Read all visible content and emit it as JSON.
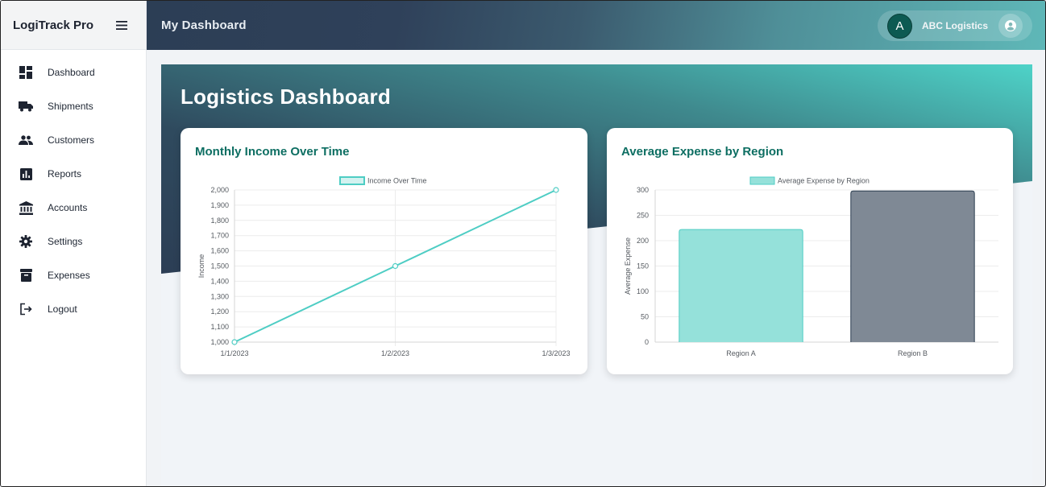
{
  "app": {
    "title": "LogiTrack Pro"
  },
  "sidebar": {
    "items": [
      {
        "label": "Dashboard",
        "icon": "dashboard-icon"
      },
      {
        "label": "Shipments",
        "icon": "truck-icon"
      },
      {
        "label": "Customers",
        "icon": "people-icon"
      },
      {
        "label": "Reports",
        "icon": "chart-icon"
      },
      {
        "label": "Accounts",
        "icon": "bank-icon"
      },
      {
        "label": "Settings",
        "icon": "gear-icon"
      },
      {
        "label": "Expenses",
        "icon": "archive-icon"
      },
      {
        "label": "Logout",
        "icon": "logout-icon"
      }
    ]
  },
  "header": {
    "title": "My Dashboard",
    "avatar_letter": "A",
    "company": "ABC Logistics"
  },
  "main": {
    "title": "Logistics Dashboard"
  },
  "colors": {
    "teal": "#4ecdc4",
    "teal_fill": "#95e1da",
    "slate": "#2c3e50",
    "slate_fill": "#7f8995",
    "card_title": "#0d6e62"
  },
  "charts": {
    "income": {
      "title": "Monthly Income Over Time"
    },
    "expense": {
      "title": "Average Expense by Region"
    }
  },
  "chart_data": [
    {
      "type": "line",
      "title": "",
      "legend": "Income Over Time",
      "x": [
        "1/1/2023",
        "1/2/2023",
        "1/3/2023"
      ],
      "series": [
        {
          "name": "Income Over Time",
          "values": [
            1000,
            1500,
            2000
          ]
        }
      ],
      "xlabel": "",
      "ylabel": "Income",
      "ylim": [
        1000,
        2000
      ],
      "yticks": [
        "1,000",
        "1,100",
        "1,200",
        "1,300",
        "1,400",
        "1,500",
        "1,600",
        "1,700",
        "1,800",
        "1,900",
        "2,000"
      ],
      "grid": true,
      "legend_position": "top"
    },
    {
      "type": "bar",
      "title": "",
      "legend": "Average Expense by Region",
      "categories": [
        "Region A",
        "Region B"
      ],
      "values": [
        222,
        298
      ],
      "xlabel": "",
      "ylabel": "Average Expense",
      "ylim": [
        0,
        300
      ],
      "yticks": [
        "0",
        "50",
        "100",
        "150",
        "200",
        "250",
        "300"
      ],
      "grid": true,
      "legend_position": "top"
    }
  ]
}
